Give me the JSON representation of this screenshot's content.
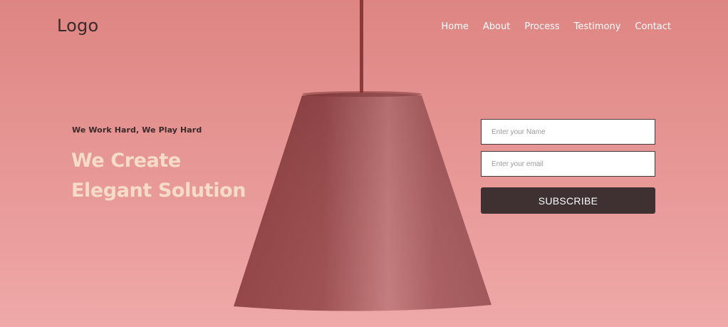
{
  "brand": {
    "logo_text": "Logo"
  },
  "nav": {
    "items": [
      {
        "label": "Home"
      },
      {
        "label": "About"
      },
      {
        "label": "Process"
      },
      {
        "label": "Testimony"
      },
      {
        "label": "Contact"
      }
    ]
  },
  "hero": {
    "tagline": "We Work Hard, We Play Hard",
    "headline_line1": "We Create",
    "headline_line2": "Elegant Solution"
  },
  "form": {
    "name_placeholder": "Enter your Name",
    "email_placeholder": "Enter your email",
    "submit_label": "SUBSCRIBE"
  },
  "colors": {
    "background_top": "#de8583",
    "background_bottom": "#efa9a8",
    "headline": "#f6dcc8",
    "button": "#3f3132"
  },
  "icons": {
    "hero_image": "pendant-lamp"
  }
}
